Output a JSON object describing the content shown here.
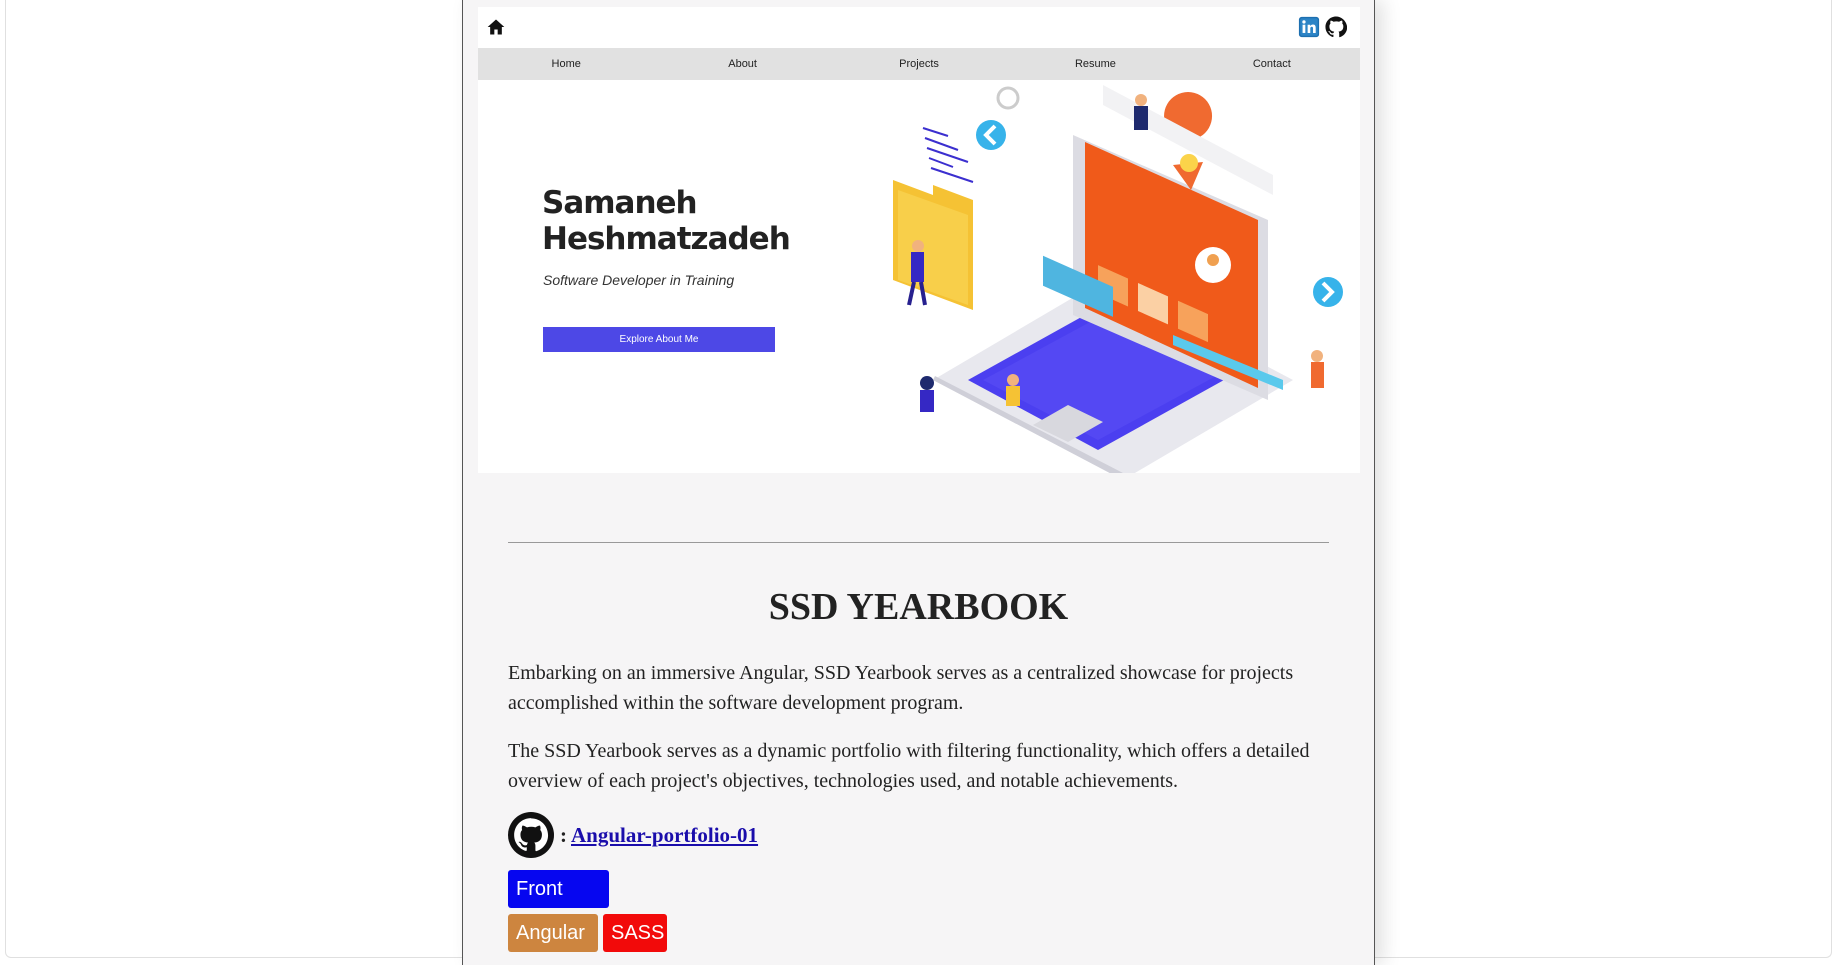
{
  "nav": {
    "items": [
      {
        "label": "Home"
      },
      {
        "label": "About"
      },
      {
        "label": "Projects"
      },
      {
        "label": "Resume"
      },
      {
        "label": "Contact"
      }
    ]
  },
  "hero": {
    "name": "Samaneh Heshmatzadeh",
    "subtitle": "Software Developer in Training",
    "cta_label": "Explore About Me"
  },
  "project": {
    "title": "SSD YEARBOOK",
    "paragraph1": "Embarking on an immersive Angular, SSD Yearbook serves as a centralized showcase for projects accomplished within the software development program.",
    "paragraph2": "The SSD Yearbook serves as a dynamic portfolio with filtering functionality, which offers a detailed overview of each project's objectives, technologies used, and notable achievements.",
    "repo_separator": ":",
    "repo_link": "Angular-portfolio-01",
    "tags": [
      {
        "label": "Front End",
        "color": "#0606f0"
      },
      {
        "label": "Angular",
        "color": "#cd853f"
      },
      {
        "label": "SASS",
        "color": "#f20a0a"
      }
    ]
  },
  "colors": {
    "accent": "#4d48e6",
    "page_background": "#f6f5f6",
    "nav_background": "#e1e1e1"
  },
  "icons": [
    "home-icon",
    "linkedin-icon",
    "github-icon"
  ]
}
